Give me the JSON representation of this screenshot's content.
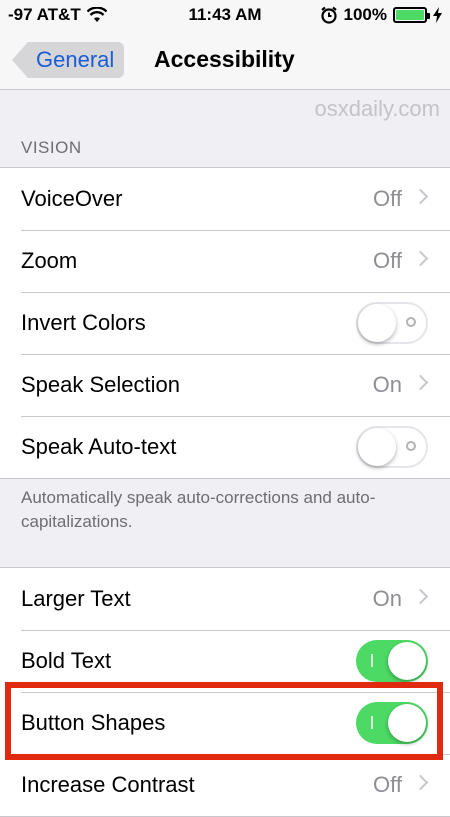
{
  "status_bar": {
    "carrier": "-97 AT&T",
    "time": "11:43 AM",
    "battery": "100%",
    "battery_level": 1.0
  },
  "nav": {
    "back_label": "General",
    "title": "Accessibility"
  },
  "watermark": "osxdaily.com",
  "vision": {
    "header": "VISION",
    "rows": [
      {
        "label": "VoiceOver",
        "value": "Off"
      },
      {
        "label": "Zoom",
        "value": "Off"
      },
      {
        "label": "Invert Colors",
        "toggle": "off"
      },
      {
        "label": "Speak Selection",
        "value": "On"
      },
      {
        "label": "Speak Auto-text",
        "toggle": "off"
      }
    ],
    "footer": "Automatically speak auto-corrections and auto-capitalizations."
  },
  "text": {
    "rows": [
      {
        "label": "Larger Text",
        "value": "On"
      },
      {
        "label": "Bold Text",
        "toggle": "on"
      },
      {
        "label": "Button Shapes",
        "toggle": "on"
      },
      {
        "label": "Increase Contrast",
        "value": "Off"
      }
    ]
  },
  "colors": {
    "accent": "#1a5dd6",
    "toggle_on": "#4cd964",
    "highlight": "#e0290f"
  },
  "icons": [
    "wifi-icon",
    "alarm-icon",
    "battery-icon",
    "charging-icon",
    "chevron-right-icon"
  ]
}
